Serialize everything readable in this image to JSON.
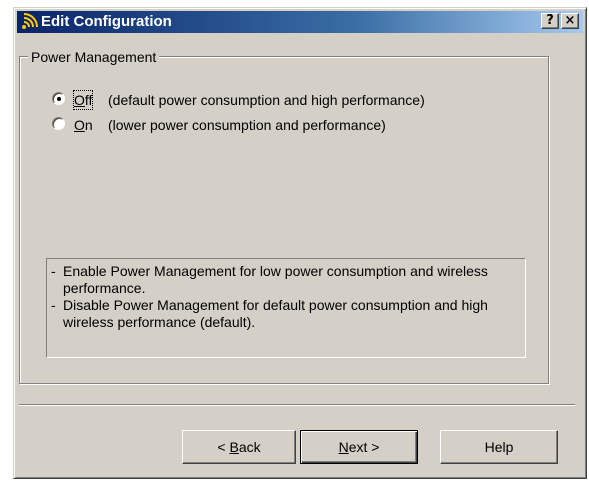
{
  "window": {
    "title": "Edit Configuration",
    "title_icon": "wireless-signal-icon",
    "help_button_label": "?",
    "close_button_label": "×"
  },
  "group": {
    "legend": "Power Management"
  },
  "options": [
    {
      "hotkey": "O",
      "label_rest": "ff",
      "description": "(default power consumption and high performance)",
      "selected": true
    },
    {
      "hotkey": "O",
      "label_rest": "n",
      "description": "(lower power consumption and performance)",
      "selected": false
    }
  ],
  "info": {
    "lines": [
      {
        "bullet": "-",
        "text": "Enable Power Management for low power consumption and wireless performance."
      },
      {
        "bullet": "-",
        "text": "Disable Power Management for default power consumption and high wireless performance (default)."
      }
    ]
  },
  "buttons": {
    "back_prefix": "< ",
    "back_hotkey": "B",
    "back_rest": "ack",
    "next_hotkey": "N",
    "next_rest": "ext >",
    "help_label": "Help"
  },
  "colors": {
    "dialog_face": "#d4d0c8",
    "title_start": "#0a246a",
    "title_end": "#a6caf0"
  }
}
